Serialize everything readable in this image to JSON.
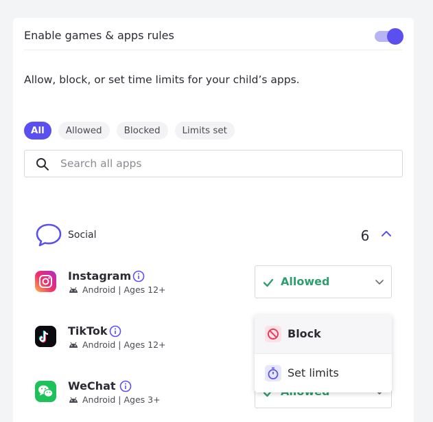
{
  "settings": {
    "toggle_label": "Enable games & apps rules",
    "toggle_on": true,
    "description": "Allow, block, or set time limits for your child’s apps."
  },
  "filters": [
    "All",
    "Allowed",
    "Blocked",
    "Limits set"
  ],
  "active_filter": "All",
  "search": {
    "placeholder": "Search all apps"
  },
  "category": {
    "name": "Social",
    "count": "6",
    "expanded": true
  },
  "apps": [
    {
      "name": "Instagram",
      "meta": "Android | Ages 12+",
      "status": "Allowed"
    },
    {
      "name": "TikTok",
      "meta": "Android | Ages 12+"
    },
    {
      "name": "WeChat",
      "meta": "Android | Ages 3+",
      "status": "Allowed"
    }
  ],
  "dropdown": {
    "items": [
      {
        "label": "Block",
        "icon": "block-icon"
      },
      {
        "label": "Set limits",
        "icon": "stopwatch-icon"
      }
    ]
  },
  "colors": {
    "accent": "#5b4ff0",
    "allowed": "#2e9e6e",
    "block": "#e2405a"
  }
}
